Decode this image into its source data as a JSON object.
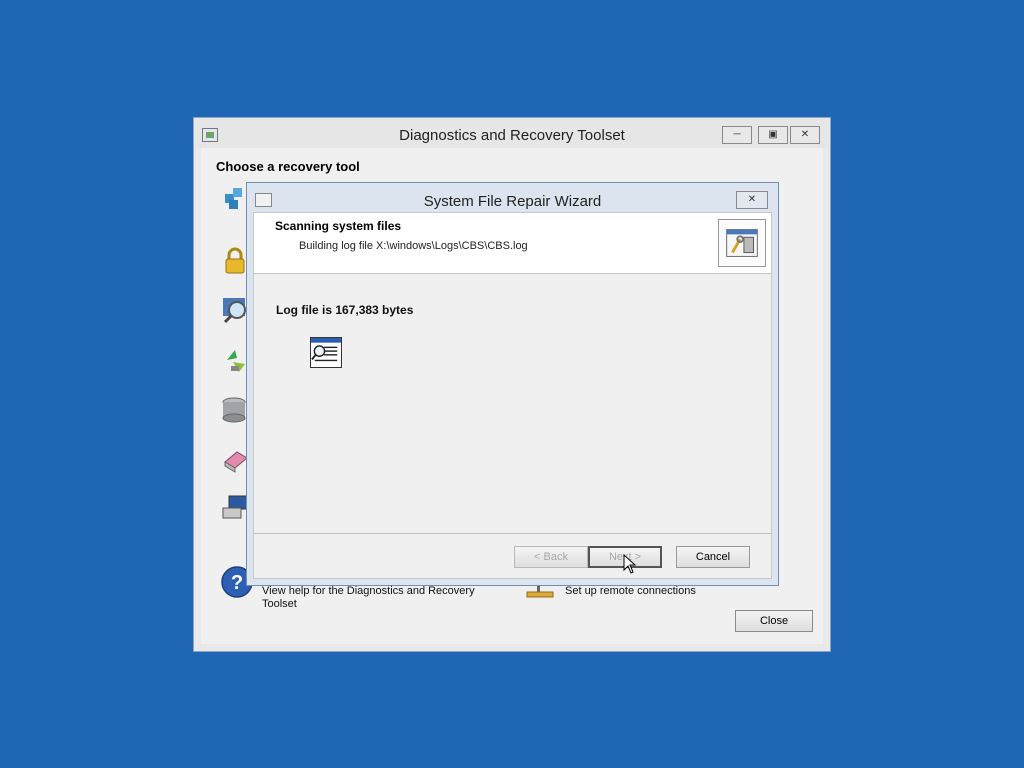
{
  "main_window": {
    "title": "Diagnostics and Recovery Toolset",
    "heading": "Choose a recovery tool",
    "help_text": "View help for the Diagnostics and Recovery Toolset",
    "remote_text": "Set up remote connections",
    "close_label": "Close",
    "tool_icons": [
      "registry-icon",
      "lock-icon",
      "search-icon",
      "recycle-icon",
      "disk-icon",
      "eraser-icon",
      "computer-icon",
      "help-icon",
      "network-icon"
    ]
  },
  "wizard": {
    "title": "System File Repair Wizard",
    "heading": "Scanning system files",
    "subheading": "Building log file X:\\windows\\Logs\\CBS\\CBS.log",
    "status": "Log file is 167,383 bytes",
    "back_label": "< Back",
    "next_label": "Next >",
    "cancel_label": "Cancel"
  }
}
